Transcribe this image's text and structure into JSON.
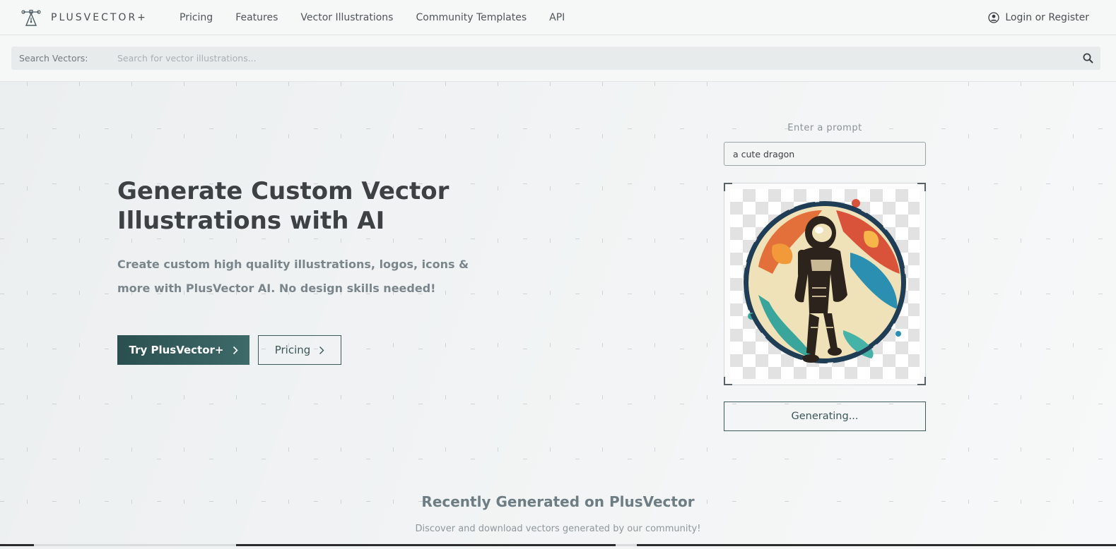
{
  "brand": {
    "name": "PLUSVECTOR+",
    "logo_icon": "pen-nib-logo-icon"
  },
  "nav": {
    "links": [
      "Pricing",
      "Features",
      "Vector Illustrations",
      "Community Templates",
      "API"
    ],
    "login_label": "Login or Register",
    "login_icon": "user-circle-icon"
  },
  "search": {
    "label": "Search Vectors:",
    "placeholder": "Search for vector illustrations...",
    "value": "",
    "icon": "search-icon"
  },
  "hero": {
    "title": "Generate Custom Vector Illustrations with AI",
    "subtitle": "Create custom high quality illustrations, logos, icons & more with PlusVector AI. No design skills needed!",
    "primary_button": "Try PlusVector+",
    "secondary_button": "Pricing"
  },
  "generator": {
    "prompt_label": "Enter a prompt",
    "prompt_value": "a cute dragon",
    "preview_subject": "astronaut-illustration",
    "status_button": "Generating..."
  },
  "recent": {
    "title": "Recently Generated on PlusVector",
    "subtitle": "Discover and download vectors generated by our community!"
  },
  "colors": {
    "accent": "#2f5555",
    "accent_light": "#3e6a6a",
    "heading": "#3d4144",
    "muted": "#7b868c",
    "background": "#eef1f2"
  }
}
